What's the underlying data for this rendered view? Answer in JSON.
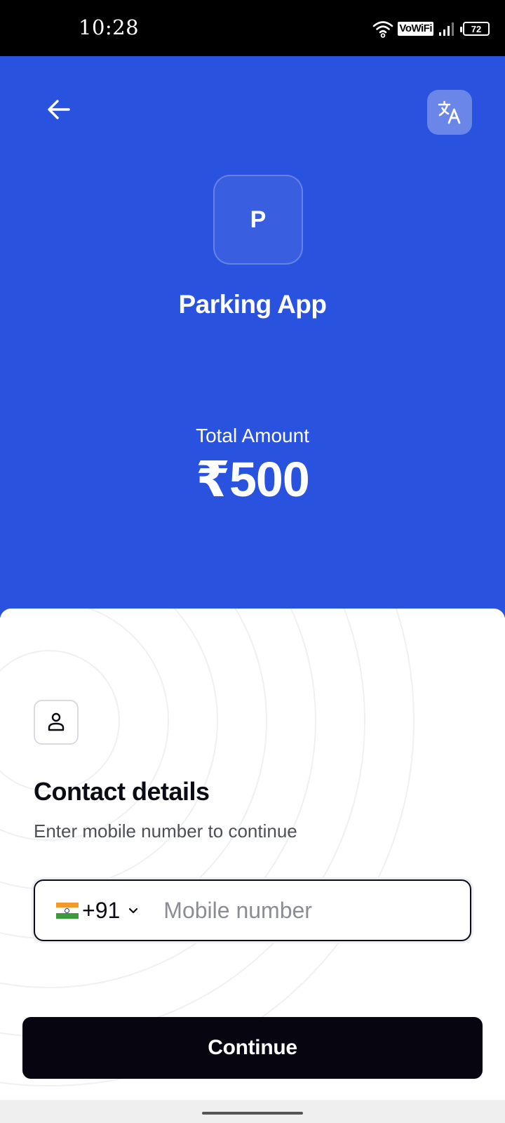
{
  "status_bar": {
    "time": "10:28",
    "vowifi": "VoWiFi",
    "battery": "72"
  },
  "header": {
    "back_icon": "arrow-left-icon",
    "translate_icon": "translate-icon",
    "logo_letter": "P",
    "app_name": "Parking App",
    "amount_label": "Total Amount",
    "amount_value": "₹500",
    "background_color": "#2952de"
  },
  "contact": {
    "icon": "person-icon",
    "title": "Contact details",
    "subtitle": "Enter mobile number to continue",
    "country_flag": "india-flag-icon",
    "country_code": "+91",
    "mobile_placeholder": "Mobile number",
    "mobile_value": ""
  },
  "actions": {
    "continue_label": "Continue",
    "continue_color": "#060510"
  }
}
